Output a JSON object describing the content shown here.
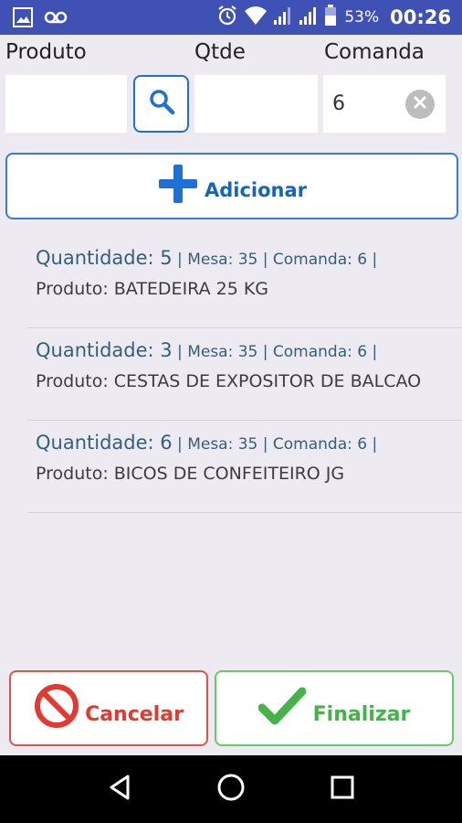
{
  "status_bar": {
    "battery_percent": "53%",
    "time": "00:26",
    "icons": [
      "image-icon",
      "voicemail-icon",
      "alarm-icon",
      "wifi-icon",
      "signal-icon",
      "signal-icon",
      "battery-icon"
    ]
  },
  "form": {
    "produto_label": "Produto",
    "qtde_label": "Qtde",
    "comanda_label": "Comanda",
    "produto_value": "",
    "qtde_value": "",
    "comanda_value": "6"
  },
  "add_button": {
    "label": "Adicionar"
  },
  "items": [
    {
      "quantidade": "Quantidade: 5",
      "meta": " | Mesa: 35 | Comanda: 6 |",
      "produto": "Produto: BATEDEIRA 25 KG"
    },
    {
      "quantidade": "Quantidade: 3",
      "meta": " | Mesa: 35 | Comanda: 6 |",
      "produto": "Produto: CESTAS DE EXPOSITOR DE BALCAO"
    },
    {
      "quantidade": "Quantidade: 6",
      "meta": " | Mesa: 35 | Comanda: 6 |",
      "produto": "Produto: BICOS DE CONFEITEIRO JG"
    }
  ],
  "actions": {
    "cancel_label": "Cancelar",
    "finish_label": "Finalizar"
  },
  "colors": {
    "status_bar": "#3f51b5",
    "accent_blue": "#1f6fd6",
    "cancel_red": "#e23a31",
    "finish_green": "#43b34a"
  }
}
